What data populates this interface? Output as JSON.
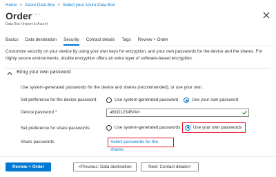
{
  "breadcrumb": {
    "items": [
      "Home",
      "Azure Data Box",
      "Select your Azure Data Box"
    ],
    "separator": ">"
  },
  "header": {
    "title": "Order",
    "more": "···",
    "subtitle": "Data Box (Import to Azure)"
  },
  "tabs": [
    {
      "label": "Basics",
      "active": false
    },
    {
      "label": "Data destination",
      "active": false
    },
    {
      "label": "Security",
      "active": true
    },
    {
      "label": "Contact details",
      "active": false
    },
    {
      "label": "Tags",
      "active": false
    },
    {
      "label": "Review + Order",
      "active": false
    }
  ],
  "intro": "Customize security on your device by using your own keys for encryption, and your own passwords for the device and the shares. For highly secure environments, double encryption offers an extra layer of software-based encryption.",
  "section": {
    "title": "Bring your own password",
    "description": "Use system-generated passwords for the device and shares (recommended), or use your own.",
    "device_pref_label": "Set preference for the device password",
    "device_options": [
      "Use system-generated password",
      "Use your own password"
    ],
    "device_selected": 1,
    "device_password_label": "Device password",
    "required_mark": "*",
    "device_password_value": "aBcD12345###",
    "share_pref_label": "Set preference for share passwords",
    "share_options": [
      "Use system-generated passwords",
      "Use your own passwords"
    ],
    "share_selected": 1,
    "share_passwords_label": "Share passwords",
    "share_link": "Select passwords for the shares"
  },
  "footer": {
    "review_button": "Review + Order",
    "prev_button": "<Previous: Data destination",
    "next_button": "Next: Contact details>"
  },
  "colors": {
    "accent": "#0078d4",
    "highlight": "#e81123",
    "valid": "#107c10"
  }
}
